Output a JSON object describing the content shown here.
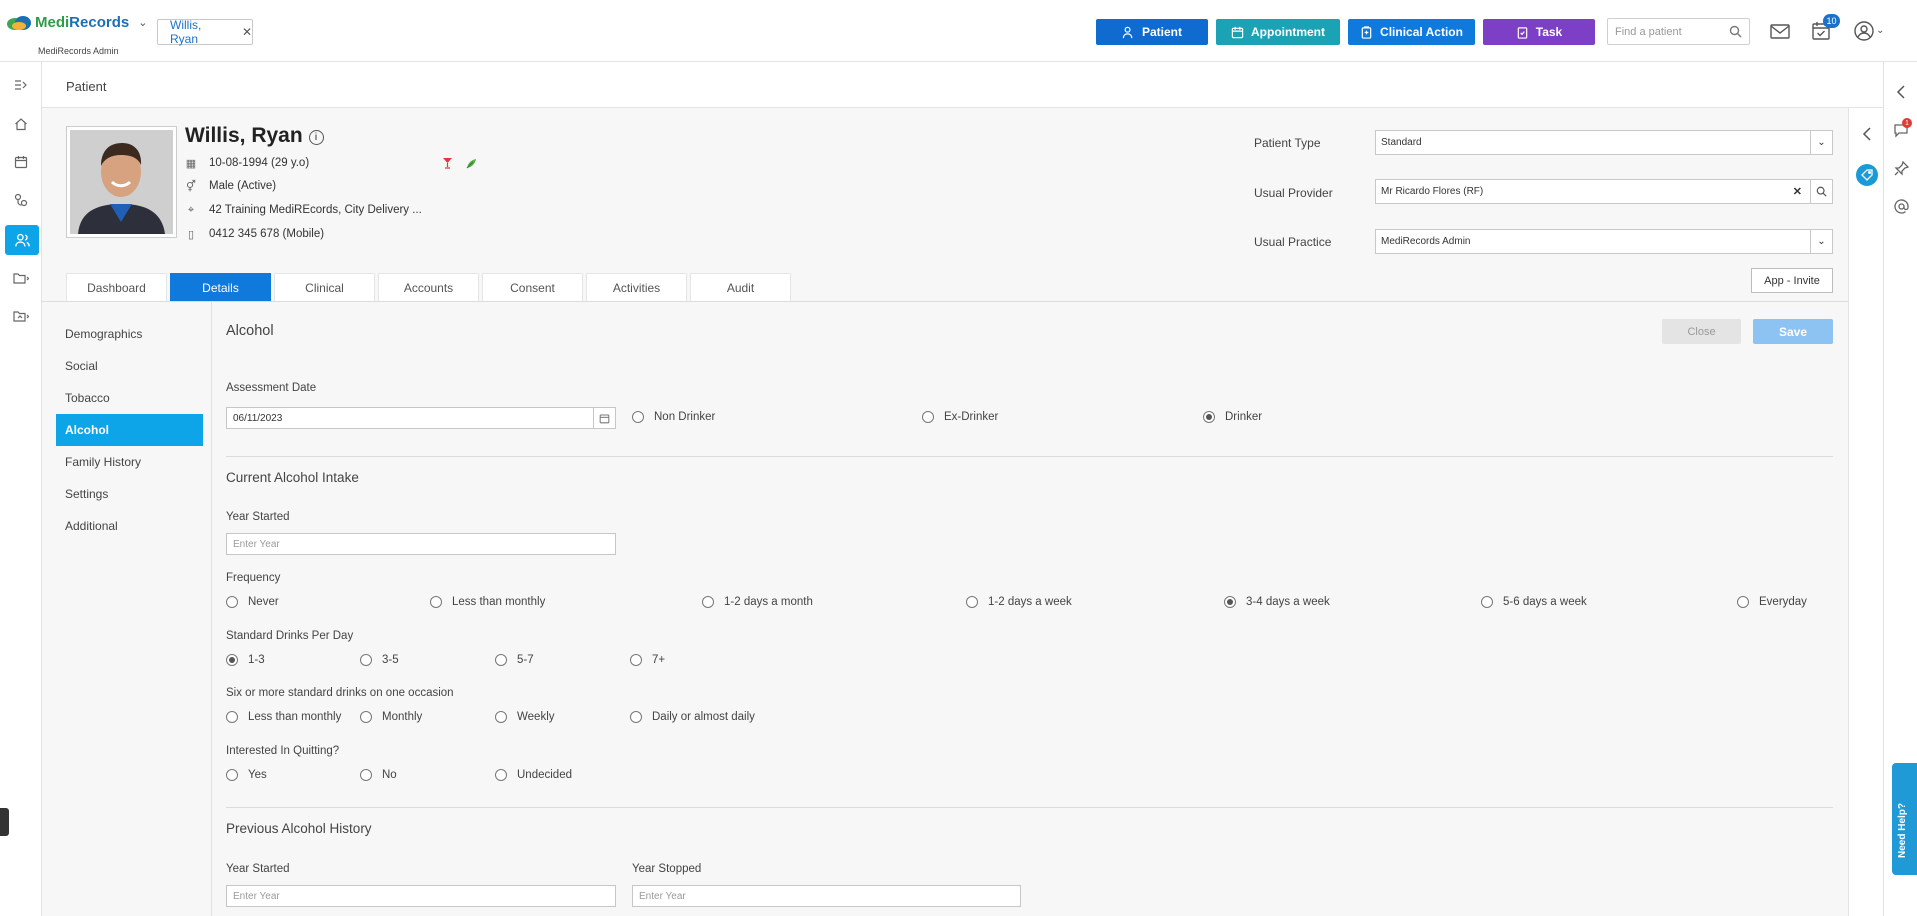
{
  "app": {
    "brand_part1": "Medi",
    "brand_part2": "Records",
    "sub": "MediRecords Admin"
  },
  "open_patient_tab": {
    "label": "Willis, Ryan"
  },
  "header_buttons": {
    "patient": "Patient",
    "appointment": "Appointment",
    "clinical_action": "Clinical Action",
    "task": "Task"
  },
  "search": {
    "placeholder": "Find a patient"
  },
  "notifications": {
    "task_count": "10",
    "chat_count": "1"
  },
  "breadcrumb": {
    "title": "Patient"
  },
  "patient": {
    "name": "Willis, Ryan",
    "dob": "10-08-1994 (29 y.o)",
    "gender": "Male (Active)",
    "address": "42 Training MediREcords, City Delivery ...",
    "phone": "0412 345 678 (Mobile)"
  },
  "fields": {
    "patient_type_label": "Patient Type",
    "patient_type_value": "Standard",
    "usual_provider_label": "Usual Provider",
    "usual_provider_value": "Mr Ricardo Flores (RF)",
    "usual_practice_label": "Usual Practice",
    "usual_practice_value": "MediRecords Admin",
    "app_invite": "App - Invite"
  },
  "tabs": [
    "Dashboard",
    "Details",
    "Clinical",
    "Accounts",
    "Consent",
    "Activities",
    "Audit"
  ],
  "active_tab": "Details",
  "sidenav": [
    "Demographics",
    "Social",
    "Tobacco",
    "Alcohol",
    "Family History",
    "Settings",
    "Additional"
  ],
  "active_sidenav": "Alcohol",
  "form": {
    "title": "Alcohol",
    "close": "Close",
    "save": "Save",
    "assessment_date_label": "Assessment Date",
    "assessment_date_value": "06/11/2023",
    "drinker_status": [
      "Non Drinker",
      "Ex-Drinker",
      "Drinker"
    ],
    "drinker_selected": "Drinker",
    "current_title": "Current Alcohol Intake",
    "year_started_label": "Year Started",
    "year_placeholder": "Enter Year",
    "frequency_label": "Frequency",
    "frequency_options": [
      "Never",
      "Less than monthly",
      "1-2 days a month",
      "1-2 days a week",
      "3-4 days a week",
      "5-6 days a week",
      "Everyday"
    ],
    "frequency_selected": "3-4 days a week",
    "std_drinks_label": "Standard Drinks Per Day",
    "std_drinks_options": [
      "1-3",
      "3-5",
      "5-7",
      "7+"
    ],
    "std_drinks_selected": "1-3",
    "six_plus_label": "Six or more standard drinks on one occasion",
    "six_plus_options": [
      "Less than monthly",
      "Monthly",
      "Weekly",
      "Daily or almost daily"
    ],
    "quitting_label": "Interested In Quitting?",
    "quitting_options": [
      "Yes",
      "No",
      "Undecided"
    ],
    "previous_title": "Previous Alcohol History",
    "prev_year_started_label": "Year Started",
    "prev_year_stopped_label": "Year Stopped"
  },
  "help": {
    "label": "Need Help?"
  },
  "colors": {
    "primary": "#0f79dc",
    "sidebar_active": "#0da4e8",
    "appointment": "#1ba3b5",
    "task": "#7e3fc7",
    "save_disabled": "#8dc3f2"
  }
}
